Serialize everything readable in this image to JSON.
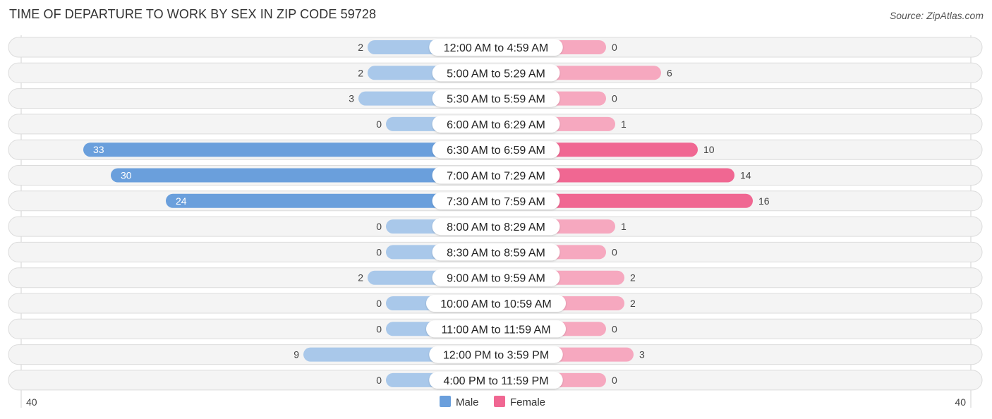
{
  "chart_data": {
    "type": "bar",
    "orientation": "horizontal-diverging",
    "title": "TIME OF DEPARTURE TO WORK BY SEX IN ZIP CODE 59728",
    "source": "Source: ZipAtlas.com",
    "categories": [
      "12:00 AM to 4:59 AM",
      "5:00 AM to 5:29 AM",
      "5:30 AM to 5:59 AM",
      "6:00 AM to 6:29 AM",
      "6:30 AM to 6:59 AM",
      "7:00 AM to 7:29 AM",
      "7:30 AM to 7:59 AM",
      "8:00 AM to 8:29 AM",
      "8:30 AM to 8:59 AM",
      "9:00 AM to 9:59 AM",
      "10:00 AM to 10:59 AM",
      "11:00 AM to 11:59 AM",
      "12:00 PM to 3:59 PM",
      "4:00 PM to 11:59 PM"
    ],
    "series": [
      {
        "name": "Male",
        "color": "#6a9fdc",
        "light_color": "#a9c8ea",
        "values": [
          2,
          2,
          3,
          0,
          33,
          30,
          24,
          0,
          0,
          2,
          0,
          0,
          9,
          0
        ]
      },
      {
        "name": "Female",
        "color": "#f06792",
        "light_color": "#f6a8bf",
        "values": [
          0,
          6,
          0,
          1,
          10,
          14,
          16,
          1,
          0,
          2,
          2,
          0,
          3,
          0
        ]
      }
    ],
    "axis": {
      "left_label": "40",
      "right_label": "40",
      "max": 40
    },
    "legend": {
      "position": "bottom-center",
      "items": [
        "Male",
        "Female"
      ]
    },
    "grid": false
  }
}
